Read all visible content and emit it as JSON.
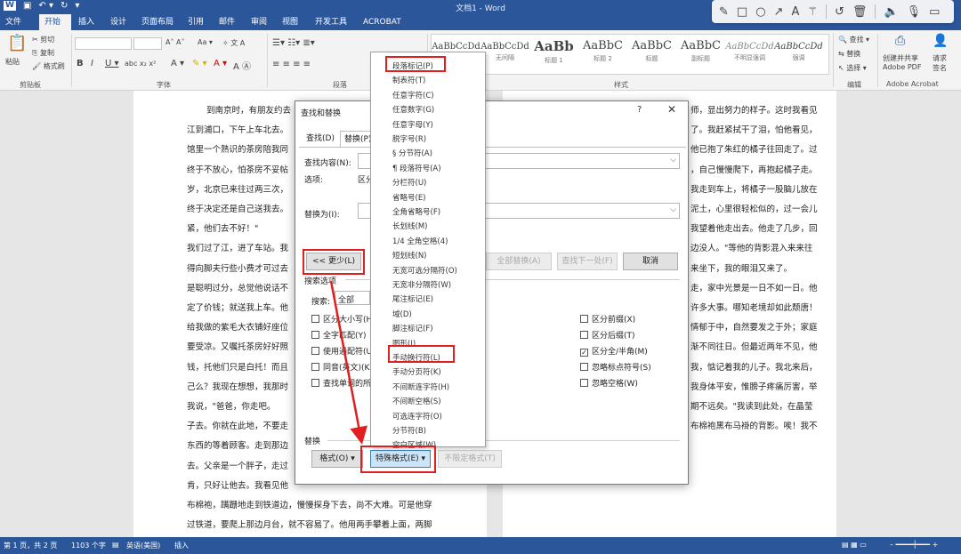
{
  "app": {
    "doc_title": "文档1 - Word"
  },
  "tabs": [
    {
      "label": "文件"
    },
    {
      "label": "开始"
    },
    {
      "label": "插入"
    },
    {
      "label": "设计"
    },
    {
      "label": "页面布局"
    },
    {
      "label": "引用"
    },
    {
      "label": "邮件"
    },
    {
      "label": "审阅"
    },
    {
      "label": "视图"
    },
    {
      "label": "开发工具"
    },
    {
      "label": "ACROBAT"
    }
  ],
  "ribbon": {
    "clipboard": {
      "paste": "粘贴",
      "cut": "剪切",
      "copy": "复制",
      "format_painter": "格式刷",
      "group_label": "剪贴板"
    },
    "font_group_label": "字体",
    "paragraph_group_label": "段落",
    "styles_group_label": "样式",
    "styles": [
      {
        "sample": "AaBbCcDd",
        "name": "正文"
      },
      {
        "sample": "AaBbCcDd",
        "name": "无间隔"
      },
      {
        "sample": "AaBb",
        "name": "标题 1"
      },
      {
        "sample": "AaBbC",
        "name": "标题 2"
      },
      {
        "sample": "AaBbC",
        "name": "标题"
      },
      {
        "sample": "AaBbC",
        "name": "副标题"
      },
      {
        "sample": "AaBbCcDd",
        "name": "不明显强调"
      },
      {
        "sample": "AaBbCcDd",
        "name": "强调"
      }
    ],
    "editing": {
      "find": "查找",
      "replace": "替换",
      "select": "选择",
      "group_label": "编辑"
    },
    "acrobat": {
      "create_share": "创建并共享",
      "adobe_pdf": "Adobe PDF",
      "request_sign": "请求",
      "sign": "签名",
      "group_label": "Adobe Acrobat"
    }
  },
  "document": {
    "left_lines": [
      "到南京时，有朋友约去",
      "江到浦口，下午上车北去。",
      "馆里一个熟识的茶房陪我同",
      "终于不放心，怕茶房不妥帖",
      "岁，北京已来往过两三次，",
      "终于决定还是自己送我去。",
      "紧，他们去不好！\"",
      "我们过了江，进了车站。我",
      "得向脚夫行些小费才可过去",
      "是聪明过分，总觉他说话不",
      "定了价钱；就送我上车。他",
      "给我做的紫毛大衣铺好座位",
      "要受凉。又嘱托茶房好好照",
      "钱，托他们只是白托！而且",
      "己么？我现在想想，我那时",
      "我说，\"爸爸，你走吧。",
      "子去。你就在此地，不要走",
      "东西的等着顾客。走到那边",
      "去。父亲是一个胖子，走过",
      "肯，只好让他去。我看见他",
      "布棉袍，蹒跚地走到铁道边，慢慢探身下去，尚不大难。可是他穿",
      "过铁道，要爬上那边月台，就不容易了。他用两手攀着上面，两脚"
    ],
    "right_lines": [
      "师，显出努力的样子。这时我看见",
      "了。我赶紧拭干了泪，怕他看见，",
      "他已抱了朱红的橘子往回走了。过",
      "，自己慢慢爬下，再抱起橘子走。",
      "我走到车上，将橘子一股脑儿放在",
      "泥土，心里很轻松似的，过一会儿",
      "我望着他走出去。他走了几步，回",
      "边没人。\"等他的背影混入来来往",
      "来坐下，我的眼泪又来了。",
      "走，家中光景是一日不如一日。他",
      "许多大事。哪知老境却如此颓唐！",
      "情郁于中，自然要发之于外；家庭",
      "渐不同往日。但最近两年不见，他",
      "我，惦记着我的儿子。我北来后，",
      "我身体平安，惟膀子疼痛厉害，举",
      "期不远矣。\"我读到此处，在晶莹",
      "布棉袍黑布马褂的背影。唉！我不"
    ]
  },
  "dialog": {
    "title": "查找和替换",
    "help": "?",
    "close": "✕",
    "tab_find": "查找(D)",
    "tab_replace": "替换(P)",
    "find_what_label": "查找内容(N):",
    "options_label": "选项:",
    "options_value": "区分",
    "replace_with_label": "替换为(I):",
    "less_button": "<< 更少(L)",
    "replace_all_button": "全部替换(A)",
    "find_next_button": "查找下一处(F)",
    "cancel_button": "取消",
    "search_options_label": "搜索选项",
    "search_label": "搜索:",
    "search_value": "全部",
    "left_checks": [
      {
        "label": "区分大小写(H)",
        "checked": false
      },
      {
        "label": "全字匹配(Y)",
        "checked": false
      },
      {
        "label": "使用通配符(U)",
        "checked": false
      },
      {
        "label": "同音(英文)(K)",
        "checked": false
      },
      {
        "label": "查找单词的所有形式(英文)(W)",
        "checked": false
      }
    ],
    "right_checks": [
      {
        "label": "区分前缀(X)",
        "checked": false
      },
      {
        "label": "区分后缀(T)",
        "checked": false
      },
      {
        "label": "区分全/半角(M)",
        "checked": true
      },
      {
        "label": "忽略标点符号(S)",
        "checked": false
      },
      {
        "label": "忽略空格(W)",
        "checked": false
      }
    ],
    "replace_section_label": "替换",
    "format_button": "格式(O) ▾",
    "special_button": "特殊格式(E) ▾",
    "no_format_button": "不限定格式(T)"
  },
  "special_menu": {
    "items": [
      "段落标记(P)",
      "制表符(T)",
      "任意字符(C)",
      "任意数字(G)",
      "任意字母(Y)",
      "脱字号(R)",
      "§ 分节符(A)",
      "¶ 段落符号(A)",
      "分栏符(U)",
      "省略号(E)",
      "全角省略号(F)",
      "长划线(M)",
      "1/4 全角空格(4)",
      "短划线(N)",
      "无宽可选分隔符(O)",
      "无宽非分隔符(W)",
      "尾注标记(E)",
      "域(D)",
      "脚注标记(F)",
      "图形(I)",
      "手动换行符(L)",
      "手动分页符(K)",
      "不间断连字符(H)",
      "不间断空格(S)",
      "可选连字符(O)",
      "分节符(B)",
      "空白区域(W)"
    ]
  },
  "status": {
    "page": "第 1 页，共 2 页",
    "words": "1103 个字",
    "lang": "英语(美国)",
    "mode": "插入"
  },
  "colors": {
    "accent": "#2b579a",
    "highlight": "#e02020"
  }
}
